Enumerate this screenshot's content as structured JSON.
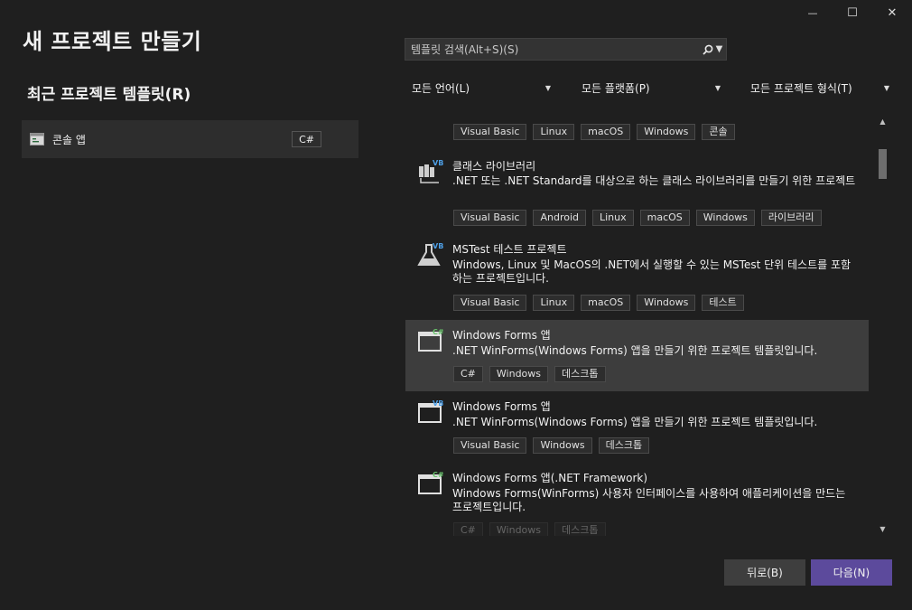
{
  "window": {
    "minimize": "—",
    "maximize": "☐",
    "close": "✕"
  },
  "page_title": "새 프로젝트 만들기",
  "recent": {
    "title": "최근 프로젝트 템플릿(R)",
    "items": [
      {
        "label": "콘솔 앱",
        "lang": "C#"
      }
    ]
  },
  "search": {
    "placeholder": "템플릿 검색(Alt+S)(S)",
    "icon": "search-icon"
  },
  "filters": {
    "language": "모든 언어(L)",
    "platform": "모든 플랫폼(P)",
    "project_type": "모든 프로젝트 형식(T)"
  },
  "templates": [
    {
      "name": "",
      "description": "",
      "tags": [
        "Visual Basic",
        "Linux",
        "macOS",
        "Windows",
        "콘솔"
      ]
    },
    {
      "name": "클래스 라이브러리",
      "description": ".NET 또는 .NET Standard를 대상으로 하는 클래스 라이브러리를 만들기 위한 프로젝트",
      "tags": [
        "Visual Basic",
        "Android",
        "Linux",
        "macOS",
        "Windows",
        "라이브러리"
      ],
      "badge": "VB"
    },
    {
      "name": "MSTest 테스트 프로젝트",
      "description": "Windows, Linux 및 MacOS의 .NET에서 실행할 수 있는 MSTest 단위 테스트를 포함하는 프로젝트입니다.",
      "tags": [
        "Visual Basic",
        "Linux",
        "macOS",
        "Windows",
        "테스트"
      ],
      "badge": "VB"
    },
    {
      "name": "Windows Forms 앱",
      "description": ".NET WinForms(Windows Forms) 앱을 만들기 위한 프로젝트 템플릿입니다.",
      "tags": [
        "C#",
        "Windows",
        "데스크톱"
      ],
      "badge": "C#",
      "selected": true
    },
    {
      "name": "Windows Forms 앱",
      "description": ".NET WinForms(Windows Forms) 앱을 만들기 위한 프로젝트 템플릿입니다.",
      "tags": [
        "Visual Basic",
        "Windows",
        "데스크톱"
      ],
      "badge": "VB"
    },
    {
      "name": "Windows Forms 앱(.NET Framework)",
      "description": "Windows Forms(WinForms) 사용자 인터페이스를 사용하여 애플리케이션을 만드는 프로젝트입니다.",
      "tags": [
        "C#",
        "Windows",
        "데스크톱"
      ],
      "badge": "C#"
    }
  ],
  "buttons": {
    "back": "뒤로(B)",
    "next": "다음(N)"
  },
  "colors": {
    "accent": "#5c4a9c",
    "selected_row": "#3d3d3d",
    "csharp_badge": "#68c26b",
    "vb_badge": "#4ea0e8"
  }
}
